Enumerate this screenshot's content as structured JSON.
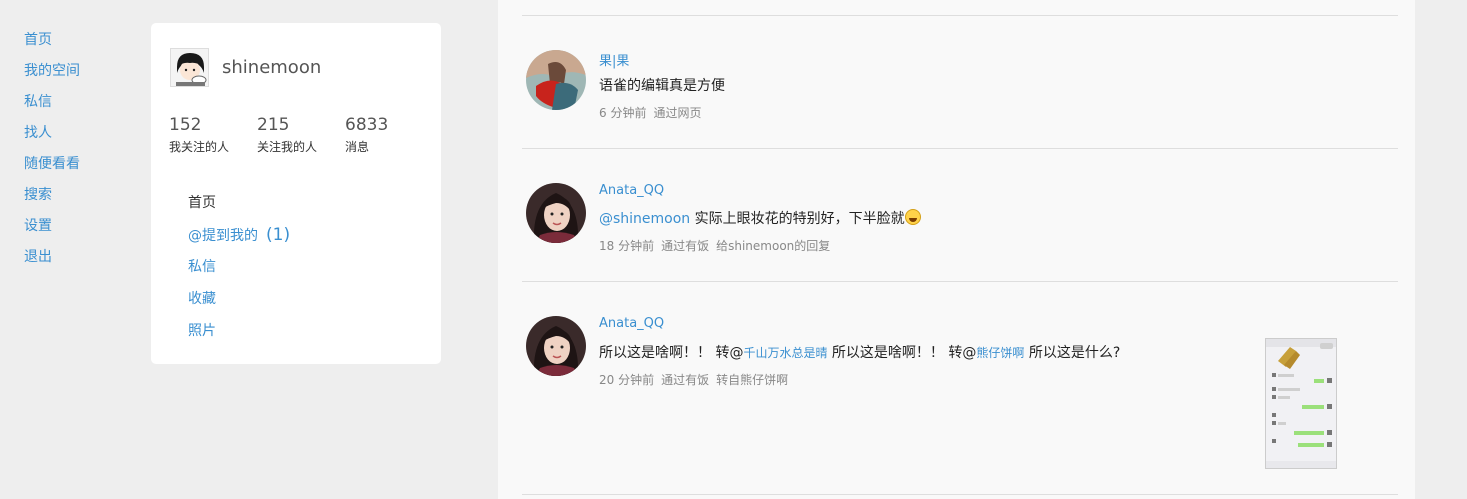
{
  "nav": [
    "首页",
    "我的空间",
    "私信",
    "找人",
    "随便看看",
    "搜索",
    "设置",
    "退出"
  ],
  "profile": {
    "username": "shinemoon",
    "stats": [
      {
        "num": "152",
        "label": "我关注的人"
      },
      {
        "num": "215",
        "label": "关注我的人"
      },
      {
        "num": "6833",
        "label": "消息"
      }
    ],
    "menu": {
      "home": "首页",
      "mentions": "@提到我的",
      "mentions_count": "(1)",
      "messages": "私信",
      "favorites": "收藏",
      "photos": "照片"
    }
  },
  "posts": [
    {
      "author": "果|果",
      "text": "语雀的编辑真是方便",
      "time": "6 分钟前",
      "via": "通过网页"
    },
    {
      "author": "Anata_QQ",
      "mention": "@shinemoon",
      "text": " 实际上眼妆花的特别好，下半脸就",
      "time": "18 分钟前",
      "via": "通过有饭",
      "reply": "给shinemoon的回复"
    },
    {
      "author": "Anata_QQ",
      "text_a": "所以这是啥啊！！ 转@",
      "mention_a": "千山万水总是晴",
      "text_b": " 所以这是啥啊！！ 转@",
      "mention_b": "熊仔饼啊",
      "text_c": " 所以这是什么?",
      "time": "20 分钟前",
      "via": "通过有饭",
      "repost": "转自熊仔饼啊"
    }
  ]
}
